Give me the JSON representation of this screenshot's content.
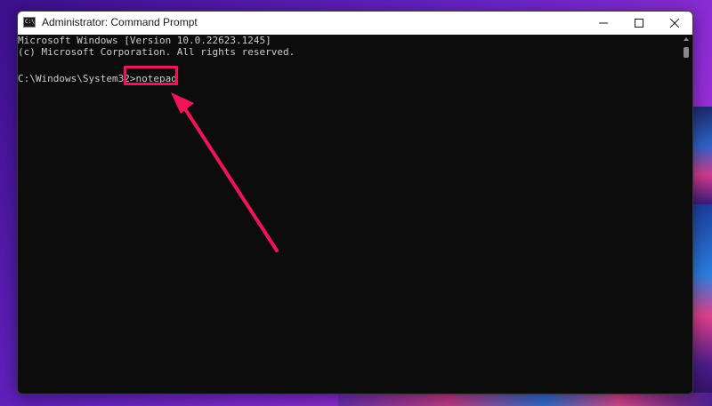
{
  "window": {
    "title": "Administrator: Command Prompt",
    "icon_label": "C:\\"
  },
  "terminal": {
    "lines": [
      "Microsoft Windows [Version 10.0.22623.1245]",
      "(c) Microsoft Corporation. All rights reserved."
    ],
    "prompt": "C:\\Windows\\System32>",
    "command": "notepad"
  },
  "controls": [
    "minimize-icon",
    "maximize-icon",
    "close-icon"
  ],
  "colors": {
    "annotation": "#f0145a",
    "terminal_bg": "#0c0c0c",
    "terminal_text": "#cccccc"
  }
}
